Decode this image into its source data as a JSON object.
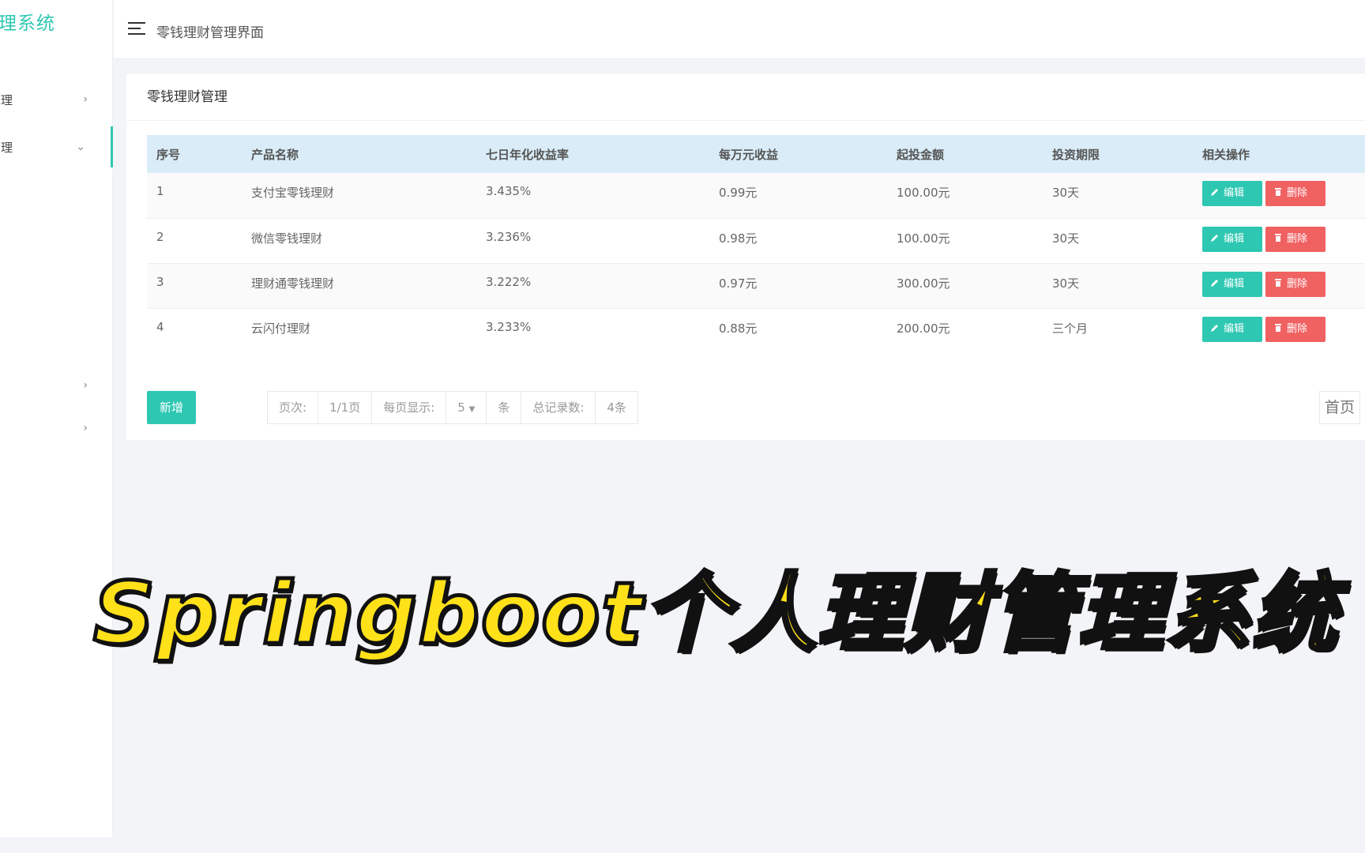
{
  "sidebar": {
    "brand": "管理系统",
    "items": [
      {
        "label": "管理",
        "arrow": "›"
      },
      {
        "label": "管理",
        "arrow": "⌄",
        "active": true
      },
      {
        "label": "",
        "arrow": "›"
      },
      {
        "label": "",
        "arrow": "›"
      }
    ]
  },
  "header": {
    "breadcrumb": "零钱理财管理界面"
  },
  "panel": {
    "title": "零钱理财管理",
    "columns": [
      "序号",
      "产品名称",
      "七日年化收益率",
      "每万元收益",
      "起投金额",
      "投资期限",
      "相关操作"
    ],
    "rows": [
      {
        "no": "1",
        "name": "支付宝零钱理财",
        "rate": "3.435%",
        "per10k": "0.99元",
        "min": "100.00元",
        "term": "30天"
      },
      {
        "no": "2",
        "name": "微信零钱理财",
        "rate": "3.236%",
        "per10k": "0.98元",
        "min": "100.00元",
        "term": "30天"
      },
      {
        "no": "3",
        "name": "理财通零钱理财",
        "rate": "3.222%",
        "per10k": "0.97元",
        "min": "300.00元",
        "term": "30天"
      },
      {
        "no": "4",
        "name": "云闪付理财",
        "rate": "3.233%",
        "per10k": "0.88元",
        "min": "200.00元",
        "term": "三个月"
      }
    ],
    "edit_label": "编辑",
    "delete_label": "删除",
    "add_label": "新增"
  },
  "pagination": {
    "page_label": "页次:",
    "page_value": "1/1页",
    "per_page_label": "每页显示:",
    "per_page_value": "5",
    "unit": "条",
    "total_label": "总记录数:",
    "total_value": "4条",
    "first_label": "首页"
  },
  "overlay_title": "Springboot个人理财管理系统",
  "colors": {
    "accent": "#2ec7b2",
    "danger": "#f06162",
    "table_header": "#d9ecf7",
    "overlay": "#ffe11a"
  }
}
